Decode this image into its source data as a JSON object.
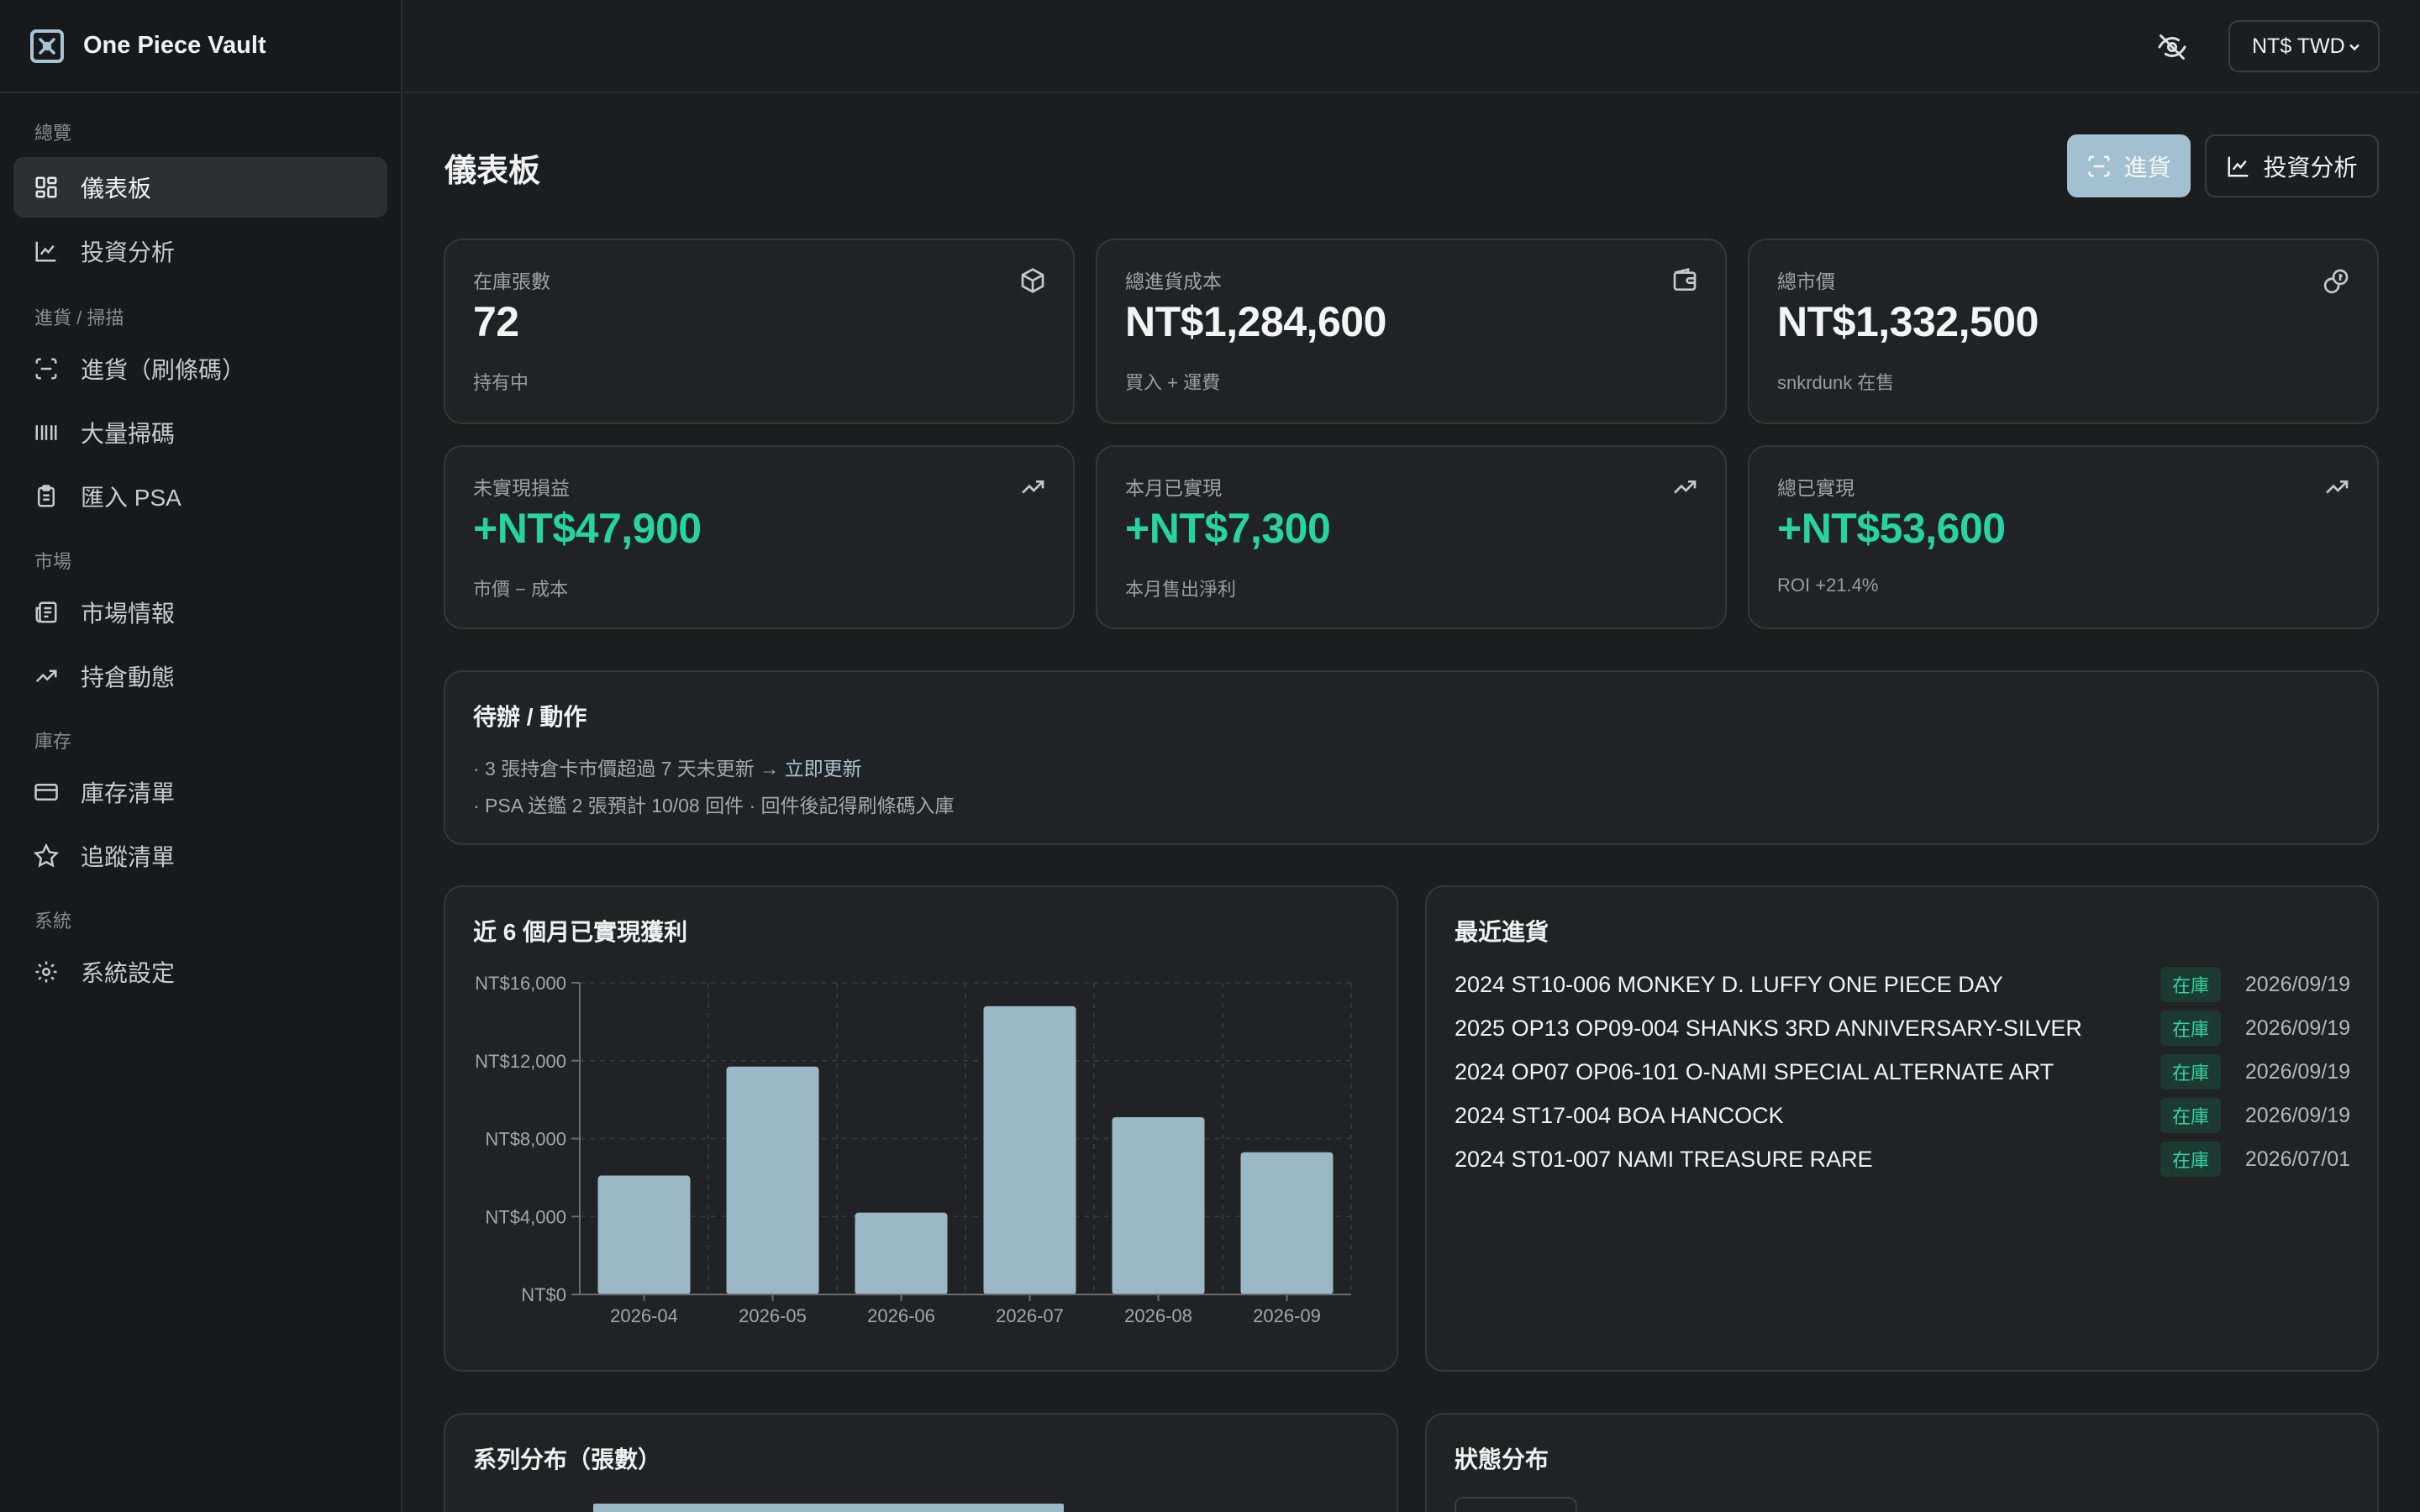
{
  "app": {
    "name": "One Piece Vault"
  },
  "sidebar": {
    "sections": [
      {
        "title": "總覽",
        "items": [
          {
            "label": "儀表板",
            "icon": "dashboard-icon",
            "active": true
          },
          {
            "label": "投資分析",
            "icon": "chart-line-icon"
          }
        ]
      },
      {
        "title": "進貨 / 掃描",
        "items": [
          {
            "label": "進貨（刷條碼）",
            "icon": "scan-icon"
          },
          {
            "label": "大量掃碼",
            "icon": "barcode-icon"
          },
          {
            "label": "匯入 PSA",
            "icon": "clipboard-icon"
          }
        ]
      },
      {
        "title": "市場",
        "items": [
          {
            "label": "市場情報",
            "icon": "newspaper-icon"
          },
          {
            "label": "持倉動態",
            "icon": "trend-up-icon"
          }
        ]
      },
      {
        "title": "庫存",
        "items": [
          {
            "label": "庫存清單",
            "icon": "card-icon"
          },
          {
            "label": "追蹤清單",
            "icon": "star-icon"
          }
        ]
      },
      {
        "title": "系統",
        "items": [
          {
            "label": "系統設定",
            "icon": "gear-icon"
          }
        ]
      }
    ]
  },
  "topbar": {
    "currency": "NT$ TWD",
    "hide_icon": "eye-off-icon"
  },
  "page": {
    "title": "儀表板",
    "primary_button": "進貨",
    "secondary_button": "投資分析"
  },
  "stats": [
    {
      "label": "在庫張數",
      "value": "72",
      "sub": "持有中",
      "icon": "box-icon",
      "positive": false
    },
    {
      "label": "總進貨成本",
      "value": "NT$1,284,600",
      "sub": "買入 + 運費",
      "icon": "wallet-icon",
      "positive": false
    },
    {
      "label": "總市價",
      "value": "NT$1,332,500",
      "sub": "snkrdunk 在售",
      "icon": "coins-icon",
      "positive": false
    },
    {
      "label": "未實現損益",
      "value": "+NT$47,900",
      "sub": "市價 − 成本",
      "icon": "trend-up-icon",
      "positive": true
    },
    {
      "label": "本月已實現",
      "value": "+NT$7,300",
      "sub": "本月售出淨利",
      "icon": "trend-up-icon",
      "positive": true
    },
    {
      "label": "總已實現",
      "value": "+NT$53,600",
      "sub": "ROI +21.4%",
      "icon": "trend-up-icon",
      "positive": true
    }
  ],
  "todo": {
    "title": "待辦 / 動作",
    "line1_prefix": "· 3 張持倉卡市價超過 7 天未更新 → ",
    "line1_link": "立即更新",
    "line2": "· PSA 送鑑 2 張預計 10/08 回件 · 回件後記得刷條碼入庫"
  },
  "profit_chart": {
    "title": "近 6 個月已實現獲利"
  },
  "chart_data": {
    "type": "bar",
    "categories": [
      "2026-04",
      "2026-05",
      "2026-06",
      "2026-07",
      "2026-08",
      "2026-09"
    ],
    "values": [
      6100,
      11700,
      4200,
      14800,
      9100,
      7300
    ],
    "ylim": [
      0,
      16000
    ],
    "yticks": [
      "NT$0",
      "NT$4,000",
      "NT$8,000",
      "NT$12,000",
      "NT$16,000"
    ],
    "ytick_values": [
      0,
      4000,
      8000,
      12000,
      16000
    ],
    "color": "#9ab8c6",
    "grid": true
  },
  "recent": {
    "title": "最近進貨",
    "rows": [
      {
        "name": "2024 ST10-006 MONKEY D. LUFFY ONE PIECE DAY",
        "status": "在庫",
        "date": "2026/09/19"
      },
      {
        "name": "2025 OP13 OP09-004 SHANKS 3RD ANNIVERSARY-SILVER",
        "status": "在庫",
        "date": "2026/09/19"
      },
      {
        "name": "2024 OP07 OP06-101 O-NAMI SPECIAL ALTERNATE ART",
        "status": "在庫",
        "date": "2026/09/19"
      },
      {
        "name": "2024 ST17-004 BOA HANCOCK",
        "status": "在庫",
        "date": "2026/09/19"
      },
      {
        "name": "2024 ST01-007 NAMI TREASURE RARE",
        "status": "在庫",
        "date": "2026/07/01"
      }
    ]
  },
  "series_dist": {
    "title": "系列分布（張數）"
  },
  "status_dist": {
    "title": "狀態分布"
  },
  "colors": {
    "accent": "#a2c0cf",
    "positive": "#27d3a0",
    "bg": "#1c1d1f",
    "card": "#212225"
  }
}
